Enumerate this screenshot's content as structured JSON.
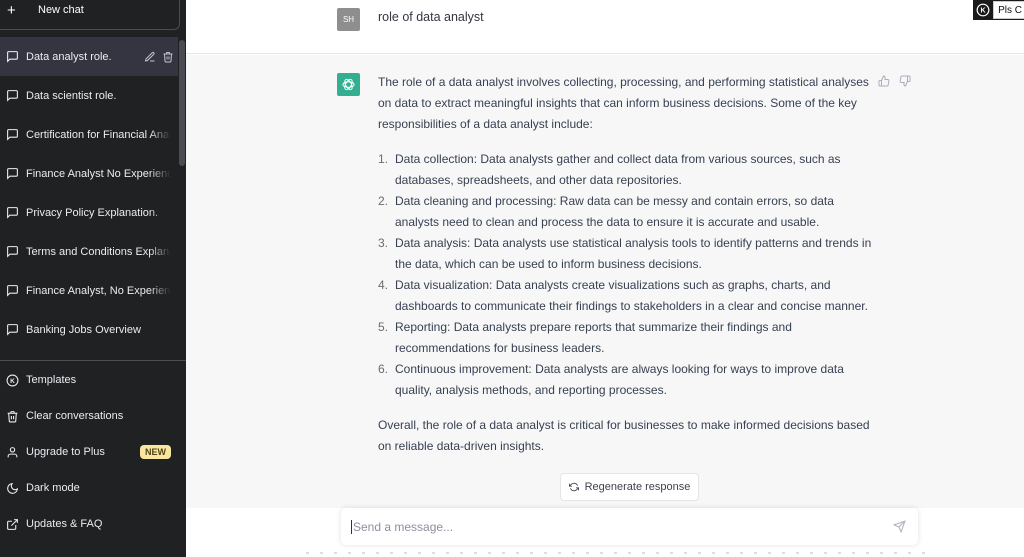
{
  "sidebar": {
    "new_chat": "New chat",
    "chats": [
      {
        "label": "Data analyst role.",
        "active": true
      },
      {
        "label": "Data scientist role."
      },
      {
        "label": "Certification for Financial Analyst"
      },
      {
        "label": "Finance Analyst No Experience"
      },
      {
        "label": "Privacy Policy Explanation."
      },
      {
        "label": "Terms and Conditions Explanation"
      },
      {
        "label": "Finance Analyst, No Experience"
      },
      {
        "label": "Banking Jobs Overview"
      }
    ],
    "menu": [
      {
        "label": "Templates",
        "icon": "k-circle-icon"
      },
      {
        "label": "Clear conversations",
        "icon": "trash-icon"
      },
      {
        "label": "Upgrade to Plus",
        "icon": "user-icon",
        "badge": "NEW"
      },
      {
        "label": "Dark mode",
        "icon": "moon-icon"
      },
      {
        "label": "Updates & FAQ",
        "icon": "external-link-icon"
      }
    ]
  },
  "conversation": {
    "user": {
      "avatar": "SH",
      "text": "role of data analyst"
    },
    "assistant": {
      "intro": "The role of a data analyst involves collecting, processing, and performing statistical analyses on data to extract meaningful insights that can inform business decisions. Some of the key responsibilities of a data analyst include:",
      "items": [
        {
          "num": "1.",
          "text": "Data collection: Data analysts gather and collect data from various sources, such as databases, spreadsheets, and other data repositories."
        },
        {
          "num": "2.",
          "text": "Data cleaning and processing: Raw data can be messy and contain errors, so data analysts need to clean and process the data to ensure it is accurate and usable."
        },
        {
          "num": "3.",
          "text": "Data analysis: Data analysts use statistical analysis tools to identify patterns and trends in the data, which can be used to inform business decisions."
        },
        {
          "num": "4.",
          "text": "Data visualization: Data analysts create visualizations such as graphs, charts, and dashboards to communicate their findings to stakeholders in a clear and concise manner."
        },
        {
          "num": "5.",
          "text": "Reporting: Data analysts prepare reports that summarize their findings and recommendations for business leaders."
        },
        {
          "num": "6.",
          "text": "Continuous improvement: Data analysts are always looking for ways to improve data quality, analysis methods, and reporting processes."
        }
      ],
      "conclusion": "Overall, the role of a data analyst is critical for businesses to make informed decisions based on reliable data-driven insights."
    }
  },
  "extension": {
    "label": "Pls C"
  },
  "composer": {
    "regenerate": "Regenerate response",
    "placeholder": "Send a message...",
    "value": ""
  },
  "colors": {
    "sidebar_bg": "#202123",
    "assistant_bg": "#f7f7f8",
    "brand_green": "#10a37f",
    "badge_bg": "#fae69e"
  }
}
